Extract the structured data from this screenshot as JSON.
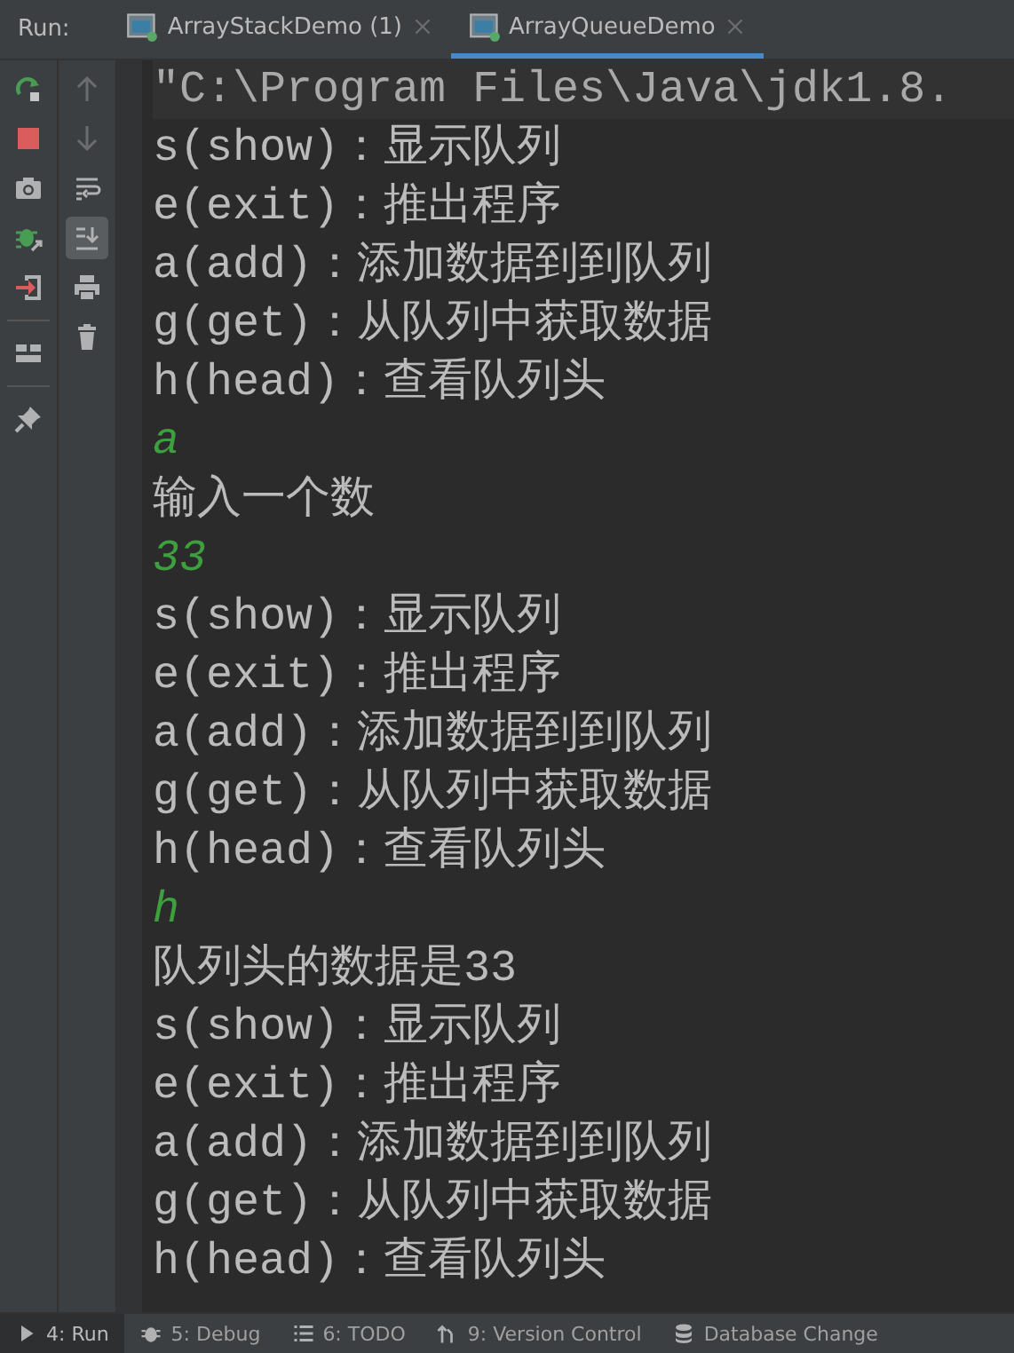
{
  "run_bar": {
    "label": "Run:",
    "tabs": [
      {
        "label": "ArrayStackDemo (1)",
        "selected": false
      },
      {
        "label": "ArrayQueueDemo",
        "selected": true
      }
    ]
  },
  "toolbar_left": [
    {
      "kind": "rerun"
    },
    {
      "kind": "stop"
    },
    {
      "kind": "camera"
    },
    {
      "kind": "debug"
    },
    {
      "kind": "exit"
    },
    {
      "kind": "layout"
    },
    {
      "kind": "pin"
    }
  ],
  "toolbar_right": [
    {
      "kind": "up",
      "disabled": true,
      "selected": false
    },
    {
      "kind": "down",
      "disabled": true,
      "selected": false
    },
    {
      "kind": "wrap",
      "disabled": false,
      "selected": false
    },
    {
      "kind": "scroll-end",
      "disabled": false,
      "selected": true
    },
    {
      "kind": "print",
      "disabled": false,
      "selected": false
    },
    {
      "kind": "trash",
      "disabled": false,
      "selected": false
    }
  ],
  "console": [
    {
      "kind": "command",
      "text": "\"C:\\Program Files\\Java\\jdk1.8."
    },
    {
      "kind": "output",
      "text": "s(show)：显示队列"
    },
    {
      "kind": "output",
      "text": "e(exit)：推出程序"
    },
    {
      "kind": "output",
      "text": "a(add)：添加数据到到队列"
    },
    {
      "kind": "output",
      "text": "g(get)：从队列中获取数据"
    },
    {
      "kind": "output",
      "text": "h(head)：查看队列头"
    },
    {
      "kind": "input",
      "text": "a"
    },
    {
      "kind": "output",
      "text": "输入一个数"
    },
    {
      "kind": "input",
      "text": "33"
    },
    {
      "kind": "output",
      "text": "s(show)：显示队列"
    },
    {
      "kind": "output",
      "text": "e(exit)：推出程序"
    },
    {
      "kind": "output",
      "text": "a(add)：添加数据到到队列"
    },
    {
      "kind": "output",
      "text": "g(get)：从队列中获取数据"
    },
    {
      "kind": "output",
      "text": "h(head)：查看队列头"
    },
    {
      "kind": "input",
      "text": "h"
    },
    {
      "kind": "output",
      "text": "队列头的数据是33"
    },
    {
      "kind": "output",
      "text": "s(show)：显示队列"
    },
    {
      "kind": "output",
      "text": "e(exit)：推出程序"
    },
    {
      "kind": "output",
      "text": "a(add)：添加数据到到队列"
    },
    {
      "kind": "output",
      "text": "g(get)：从队列中获取数据"
    },
    {
      "kind": "output",
      "text": "h(head)：查看队列头"
    }
  ],
  "tool_windows": [
    {
      "kind": "run",
      "label": "4: Run",
      "selected": true
    },
    {
      "kind": "debug",
      "label": "5: Debug",
      "selected": false
    },
    {
      "kind": "todo",
      "label": "6: TODO",
      "selected": false
    },
    {
      "kind": "vcs",
      "label": "9: Version Control",
      "selected": false
    },
    {
      "kind": "database",
      "label": "Database Change",
      "selected": false
    }
  ]
}
